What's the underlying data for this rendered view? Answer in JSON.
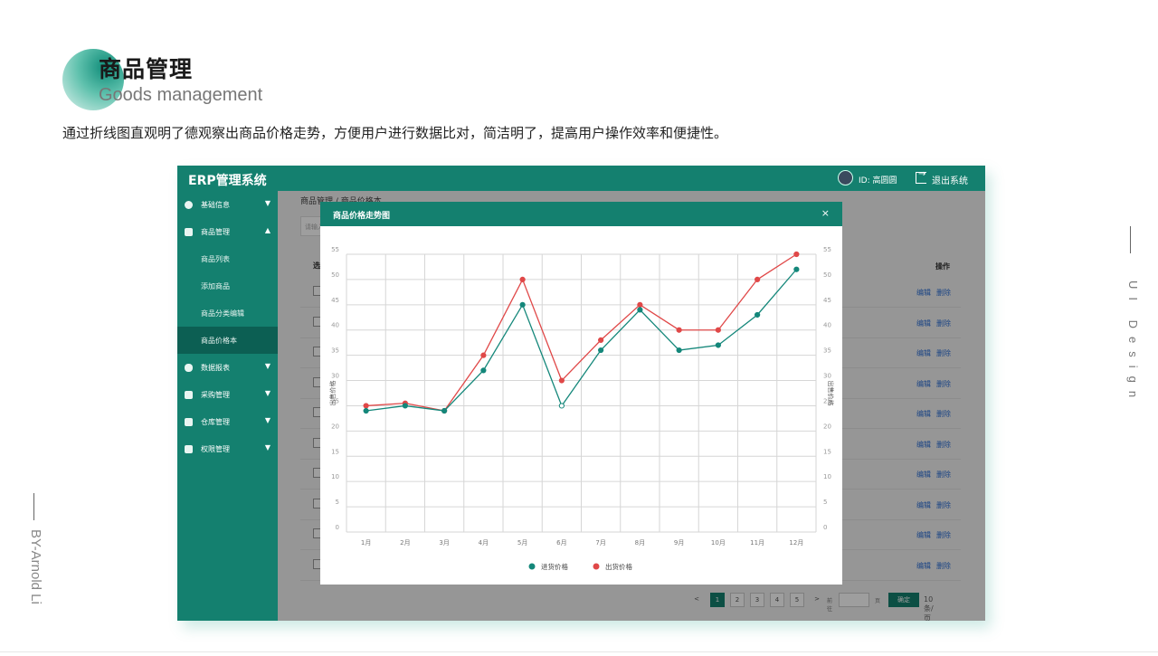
{
  "page": {
    "title": "商品管理",
    "subtitle": "Goods management",
    "description": "通过折线图直观明了德观察出商品价格走势，方便用户进行数据比对，简洁明了，提高用户操作效率和便捷性。",
    "side_right": "UI Design",
    "side_left": "BY-Arnold Li"
  },
  "app": {
    "brand": "ERP管理系统",
    "user_id_label": "ID:  高圆圆",
    "logout_label": "退出系统",
    "colors": {
      "primary": "#14806f",
      "active": "#0c5f53",
      "link": "#2d6fd6"
    },
    "sidebar": {
      "items": [
        {
          "label": "基础信息",
          "icon": "info-icon",
          "caret": "▼"
        },
        {
          "label": "商品管理",
          "icon": "goods-icon",
          "caret": "▲"
        },
        {
          "label": "数据报表",
          "icon": "database-icon",
          "caret": "▼"
        },
        {
          "label": "采购管理",
          "icon": "purchase-icon",
          "caret": "▼"
        },
        {
          "label": "仓库管理",
          "icon": "warehouse-icon",
          "caret": "▼"
        },
        {
          "label": "权限管理",
          "icon": "lock-icon",
          "caret": "▼"
        }
      ],
      "sub_items": [
        "商品列表",
        "添加商品",
        "商品分类编辑",
        "商品价格本"
      ],
      "active_sub": "商品价格本"
    },
    "breadcrumb": "商品管理 / 商品价格本",
    "filter_placeholder": "请输入",
    "table": {
      "col_select": "选",
      "col_ops": "操作",
      "edit_label": "编辑",
      "delete_label": "删除"
    },
    "pager": {
      "prev": "<",
      "pages": [
        "1",
        "2",
        "3",
        "4",
        "5"
      ],
      "active_page": "1",
      "next": ">",
      "goto_label": "前往",
      "page_suffix": "页",
      "confirm": "确定",
      "page_size": "10条/页 ∨"
    },
    "modal": {
      "title": "商品价格走势图",
      "close": "×"
    }
  },
  "chart_data": {
    "type": "line",
    "categories": [
      "1月",
      "2月",
      "3月",
      "4月",
      "5月",
      "6月",
      "7月",
      "8月",
      "9月",
      "10月",
      "11月",
      "12月"
    ],
    "ylabel": "出售价格",
    "ylabel_right": "出售价格",
    "ylim": [
      0,
      55
    ],
    "yticks": [
      0,
      5,
      10,
      15,
      20,
      25,
      30,
      35,
      40,
      45,
      50,
      55
    ],
    "grid": true,
    "legend_position": "bottom",
    "series": [
      {
        "name": "进货价格",
        "color": "#14877a",
        "values": [
          24,
          25,
          24,
          32,
          45,
          25,
          36,
          44,
          36,
          37,
          43,
          52
        ]
      },
      {
        "name": "出货价格",
        "color": "#e04848",
        "values": [
          25,
          25.5,
          24,
          35,
          50,
          30,
          38,
          45,
          40,
          40,
          50,
          55
        ]
      }
    ]
  }
}
